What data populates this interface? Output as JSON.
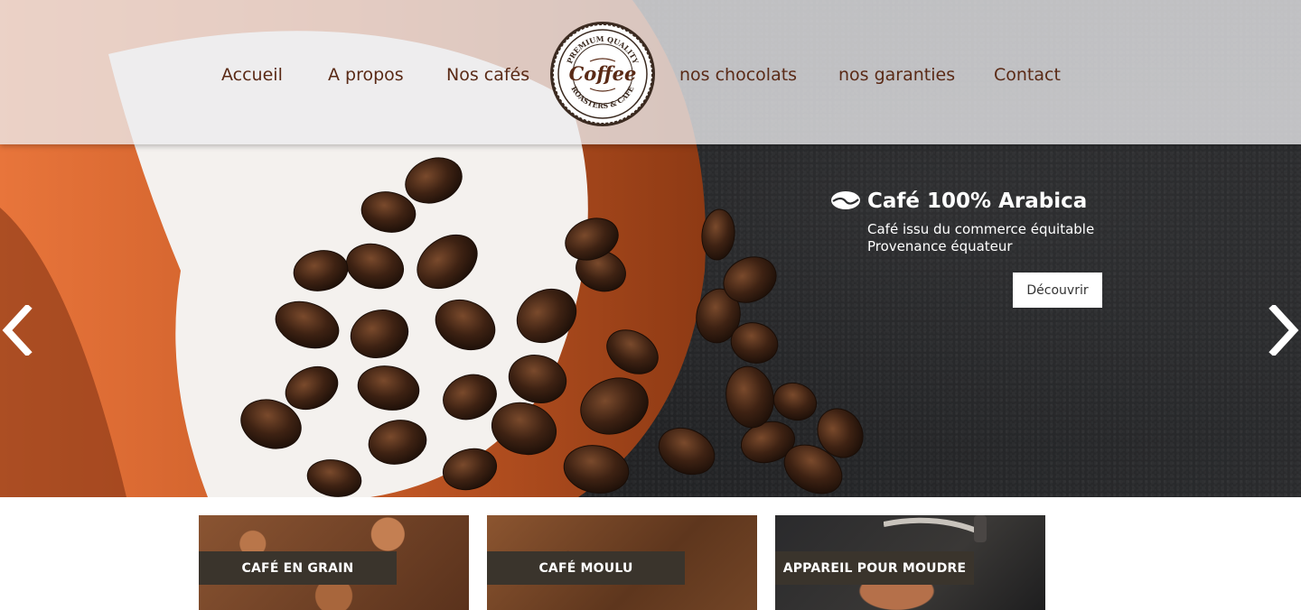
{
  "nav": {
    "items": [
      "Accueil",
      "A propos",
      "Nos cafés",
      "nos chocolats",
      "nos garanties",
      "Contact"
    ]
  },
  "logo": {
    "top_text": "PREMIUM QUALITY",
    "main": "Coffee",
    "bottom_text": "ROASTERS & CAFE"
  },
  "slide": {
    "title": "Café 100% Arabica",
    "line1": "Café issu du commerce équitable",
    "line2": "Provenance équateur",
    "button": "Découvrir"
  },
  "slider": {
    "prev_icon": "chevron-left-icon",
    "next_icon": "chevron-right-icon"
  },
  "cards": [
    {
      "label": "CAFÉ EN GRAIN"
    },
    {
      "label": "CAFÉ MOULU"
    },
    {
      "label": "APPAREIL POUR MOUDRE"
    }
  ],
  "colors": {
    "nav_text": "#5a2a16",
    "card_label_bg": "#3a342c",
    "cup_orange": "#c75a26"
  }
}
